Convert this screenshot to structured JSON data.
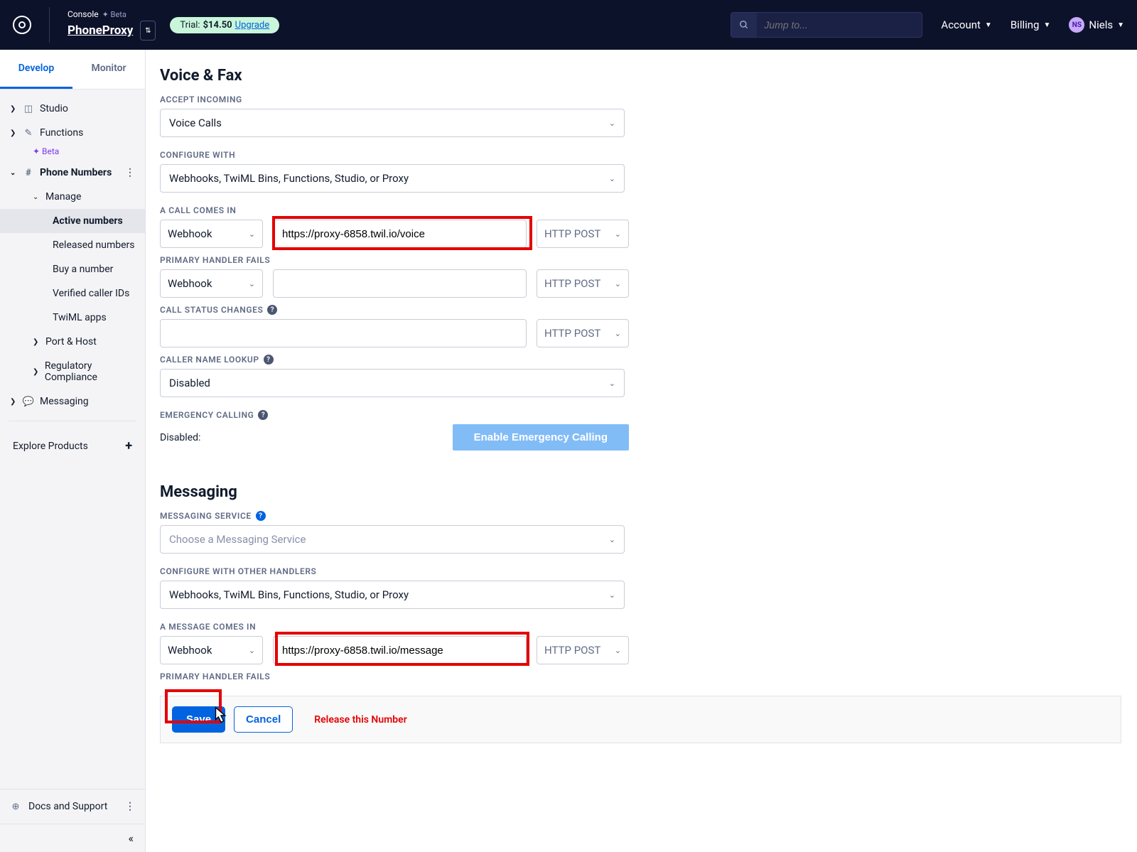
{
  "topbar": {
    "console_label": "Console",
    "beta_label": "✦ Beta",
    "project_name": "PhoneProxy",
    "trial_prefix": "Trial:",
    "trial_price": "$14.50",
    "upgrade": "Upgrade",
    "search_placeholder": "Jump to...",
    "account": "Account",
    "billing": "Billing",
    "user_initials": "NS",
    "user_name": "Niels"
  },
  "sidebar": {
    "tabs": {
      "develop": "Develop",
      "monitor": "Monitor"
    },
    "studio": "Studio",
    "functions": "Functions",
    "beta": "✦ Beta",
    "phone_numbers": "Phone Numbers",
    "manage": "Manage",
    "active_numbers": "Active numbers",
    "released_numbers": "Released numbers",
    "buy_a_number": "Buy a number",
    "verified_caller_ids": "Verified caller IDs",
    "twiml_apps": "TwiML apps",
    "port_host": "Port & Host",
    "regulatory": "Regulatory Compliance",
    "messaging": "Messaging",
    "explore": "Explore Products",
    "docs": "Docs and Support"
  },
  "voice": {
    "title": "Voice & Fax",
    "accept_incoming": "ACCEPT INCOMING",
    "accept_incoming_val": "Voice Calls",
    "configure_with": "CONFIGURE WITH",
    "configure_with_val": "Webhooks, TwiML Bins, Functions, Studio, or Proxy",
    "call_comes_in": "A CALL COMES IN",
    "webhook": "Webhook",
    "voice_url": "https://proxy-6858.twil.io/voice",
    "http_post": "HTTP POST",
    "primary_fails": "PRIMARY HANDLER FAILS",
    "call_status": "CALL STATUS CHANGES",
    "caller_lookup": "CALLER NAME LOOKUP",
    "disabled": "Disabled",
    "emergency": "EMERGENCY CALLING",
    "emerg_disabled": "Disabled:",
    "emerg_btn": "Enable Emergency Calling"
  },
  "messaging": {
    "title": "Messaging",
    "service": "MESSAGING SERVICE",
    "service_placeholder": "Choose a Messaging Service",
    "configure_other": "CONFIGURE WITH OTHER HANDLERS",
    "configure_other_val": "Webhooks, TwiML Bins, Functions, Studio, or Proxy",
    "msg_comes_in": "A MESSAGE COMES IN",
    "webhook": "Webhook",
    "msg_url": "https://proxy-6858.twil.io/message",
    "http_post": "HTTP POST",
    "primary_fails": "PRIMARY HANDLER FAILS"
  },
  "footer": {
    "save": "Save",
    "cancel": "Cancel",
    "release": "Release this Number"
  }
}
